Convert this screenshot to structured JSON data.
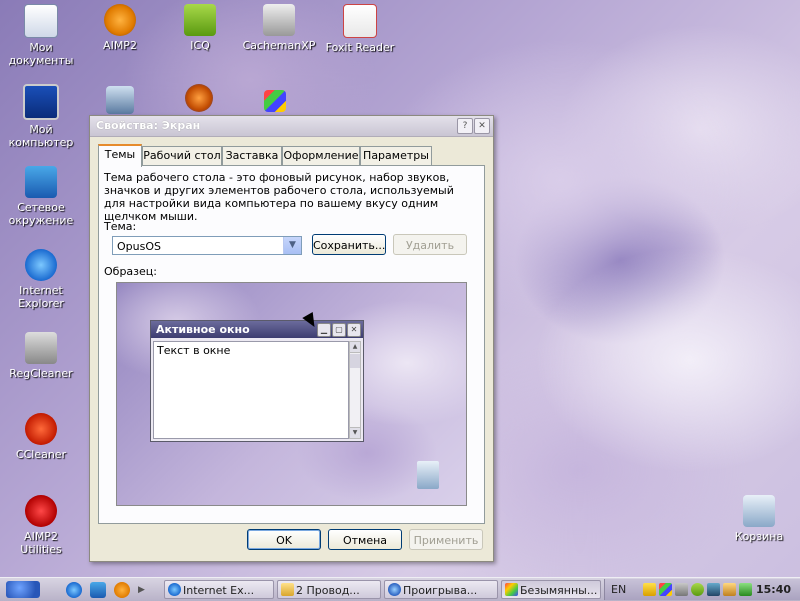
{
  "desktop": {
    "icons": [
      {
        "label": "Мои документы",
        "icon": "my-documents-icon"
      },
      {
        "label": "AIMP2",
        "icon": "aimp2-icon"
      },
      {
        "label": "ICQ",
        "icon": "icq-icon"
      },
      {
        "label": "CachemanXP",
        "icon": "cachemanxp-icon"
      },
      {
        "label": "Foxit Reader",
        "icon": "foxit-reader-icon"
      },
      {
        "label": "Мой компьютер",
        "icon": "my-computer-icon"
      },
      {
        "label": "Сетевое окружение",
        "icon": "network-icon"
      },
      {
        "label": "Internet Explorer",
        "icon": "internet-explorer-icon"
      },
      {
        "label": "RegCleaner",
        "icon": "regcleaner-icon"
      },
      {
        "label": "CCleaner",
        "icon": "ccleaner-icon"
      },
      {
        "label": "AIMP2 Utilities",
        "icon": "aimp2-utilities-icon"
      },
      {
        "label": "Корзина",
        "icon": "recycle-bin-icon"
      }
    ]
  },
  "dialog": {
    "title": "Свойства: Экран",
    "help": "?",
    "close": "✕",
    "tabs": [
      "Темы",
      "Рабочий стол",
      "Заставка",
      "Оформление",
      "Параметры"
    ],
    "description": "Тема рабочего стола - это фоновый рисунок, набор звуков, значков и других элементов рабочего стола, используемый для настройки вида компьютера по вашему вкусу одним щелчком мыши.",
    "theme_label": "Тема:",
    "theme_value": "OpusOS",
    "save_button": "Сохранить...",
    "delete_button": "Удалить",
    "sample_label": "Образец:",
    "preview": {
      "window_title": "Активное окно",
      "window_text": "Текст в окне"
    },
    "ok_button": "OK",
    "cancel_button": "Отмена",
    "apply_button": "Применить"
  },
  "taskbar": {
    "tasks": [
      {
        "label": "Internet Ex...",
        "icon": "internet-explorer-icon"
      },
      {
        "label": "2 Провод...",
        "icon": "folder-icon"
      },
      {
        "label": "Проигрыва...",
        "icon": "media-player-icon"
      },
      {
        "label": "Безымянны...",
        "icon": "paint-icon"
      }
    ],
    "language": "EN",
    "clock": "15:40"
  }
}
